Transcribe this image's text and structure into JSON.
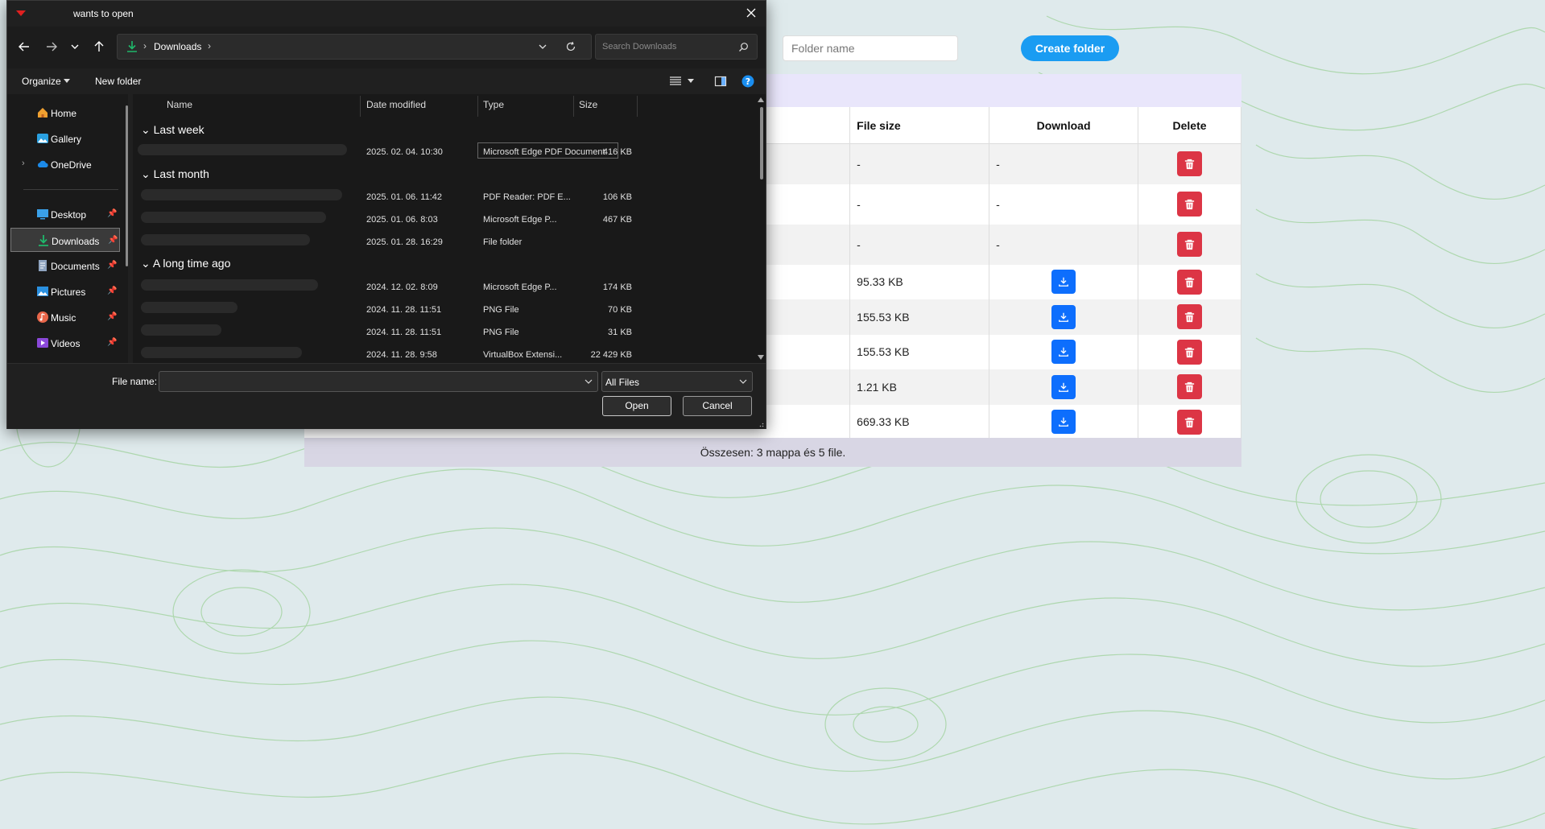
{
  "web": {
    "folder_input_placeholder": "Folder name",
    "create_folder_label": "Create folder",
    "table": {
      "headers": {
        "size": "File size",
        "download": "Download",
        "delete": "Delete"
      },
      "rows": [
        {
          "size": "-",
          "download": "-",
          "has_download": false
        },
        {
          "size": "-",
          "download": "-",
          "has_download": false
        },
        {
          "size": "-",
          "download": "-",
          "has_download": false
        },
        {
          "size": "95.33 KB",
          "has_download": true
        },
        {
          "size": "155.53 KB",
          "has_download": true
        },
        {
          "size": "155.53 KB",
          "has_download": true
        },
        {
          "size": "1.21 KB",
          "has_download": true
        },
        {
          "size": "669.33 KB",
          "has_download": true
        }
      ]
    },
    "footer": "Összesen: 3 mappa és 5 file."
  },
  "dialog": {
    "title": "wants to open",
    "address": "Downloads",
    "search_placeholder": "Search Downloads",
    "organize": "Organize",
    "new_folder": "New folder",
    "sidebar": {
      "home": "Home",
      "gallery": "Gallery",
      "onedrive": "OneDrive",
      "desktop": "Desktop",
      "downloads": "Downloads",
      "documents": "Documents",
      "pictures": "Pictures",
      "music": "Music",
      "videos": "Videos"
    },
    "columns": {
      "name": "Name",
      "date": "Date modified",
      "type": "Type",
      "size": "Size"
    },
    "groups": {
      "last_week": "Last week",
      "last_month": "Last month",
      "long_ago": "A long time ago"
    },
    "files": [
      {
        "date": "2025. 02. 04. 10:30",
        "type": "Microsoft Edge PDF Document",
        "size": "416 KB"
      },
      {
        "date": "2025. 01. 06. 11:42",
        "type": "PDF Reader: PDF E...",
        "size": "106 KB"
      },
      {
        "date": "2025. 01. 06. 8:03",
        "type": "Microsoft Edge P...",
        "size": "467 KB"
      },
      {
        "date": "2025. 01. 28. 16:29",
        "type": "File folder",
        "size": ""
      },
      {
        "date": "2024. 12. 02. 8:09",
        "type": "Microsoft Edge P...",
        "size": "174 KB"
      },
      {
        "date": "2024. 11. 28. 11:51",
        "type": "PNG File",
        "size": "70 KB"
      },
      {
        "date": "2024. 11. 28. 11:51",
        "type": "PNG File",
        "size": "31 KB"
      },
      {
        "date": "2024. 11. 28. 9:58",
        "type": "VirtualBox Extensi...",
        "size": "22 429 KB"
      }
    ],
    "file_name_label": "File name:",
    "file_name_value": "",
    "file_type": "All Files",
    "open": "Open",
    "cancel": "Cancel"
  }
}
